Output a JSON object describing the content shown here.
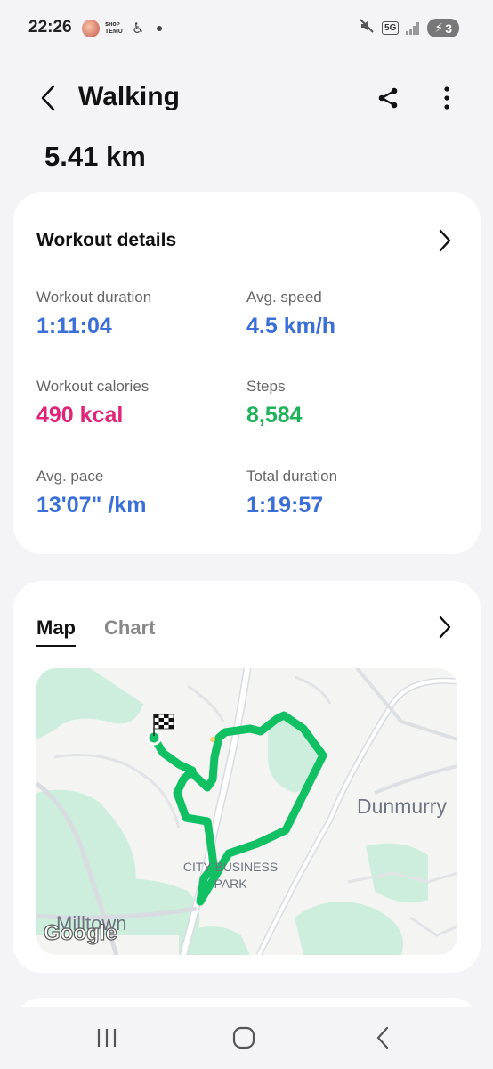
{
  "status_bar": {
    "time": "22:26",
    "temu_text": "ꜱʜᴏᴘ TEMU",
    "network": "5G",
    "battery": "3"
  },
  "header": {
    "title": "Walking",
    "back_icon": "back-arrow-icon",
    "share_icon": "share-icon",
    "more_icon": "more-vertical-icon"
  },
  "summary": {
    "distance": "5.41 km"
  },
  "workout_details": {
    "title": "Workout details",
    "stats": [
      {
        "label": "Workout duration",
        "value": "1:11:04",
        "color": "#3a6fd8"
      },
      {
        "label": "Avg. speed",
        "value": "4.5 km/h",
        "color": "#3a6fd8"
      },
      {
        "label": "Workout calories",
        "value": "490 kcal",
        "color": "#e0247a"
      },
      {
        "label": "Steps",
        "value": "8,584",
        "color": "#1eb35b"
      },
      {
        "label": "Avg. pace",
        "value": "13'07\" /km",
        "color": "#3a6fd8"
      },
      {
        "label": "Total duration",
        "value": "1:19:57",
        "color": "#3a6fd8"
      }
    ]
  },
  "map_card": {
    "tabs": [
      {
        "label": "Map",
        "active": true
      },
      {
        "label": "Chart",
        "active": false
      }
    ],
    "map_labels": {
      "dunmurry": "Dunmurry",
      "business_park": "CITY BUSINESS PARK",
      "milltown": "Milltown",
      "google": "Google"
    },
    "route_color": "#12c064"
  }
}
